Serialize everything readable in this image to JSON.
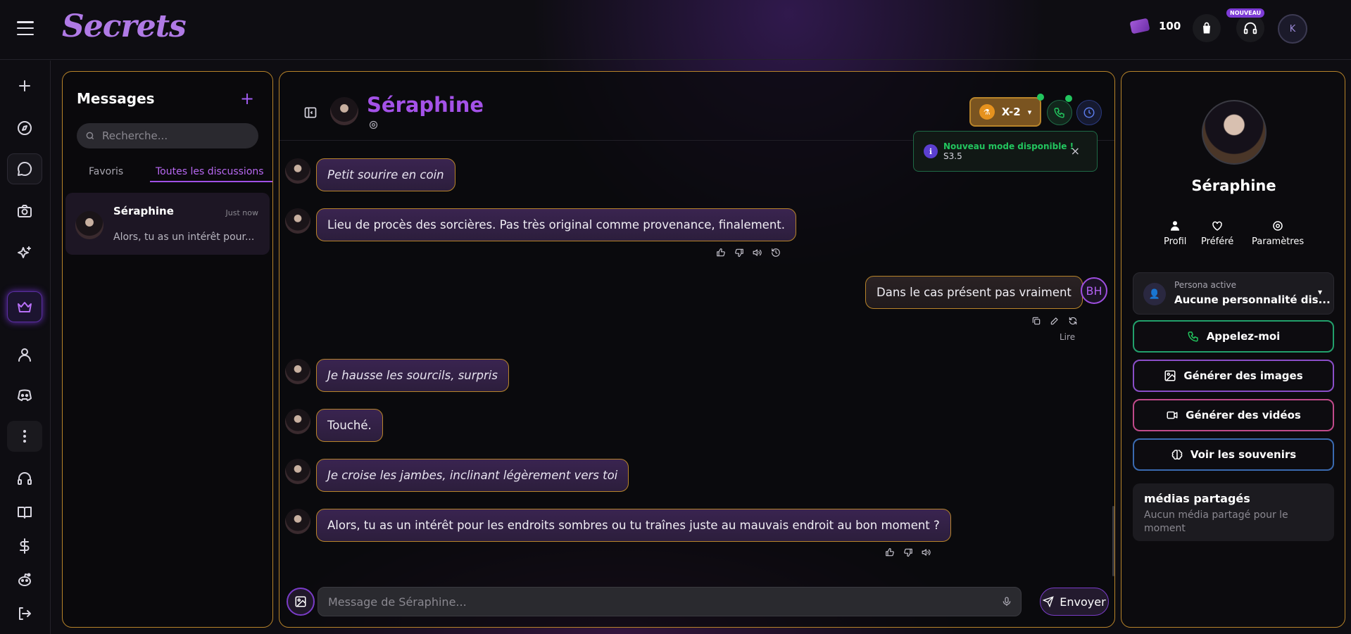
{
  "app": {
    "logo": "Secrets"
  },
  "topbar": {
    "gems_count": "100",
    "new_badge": "NOUVEAU",
    "user_initial": "K"
  },
  "messages": {
    "title": "Messages",
    "search_placeholder": "Recherche...",
    "tabs": [
      {
        "label": "Favoris"
      },
      {
        "label": "Toutes les discussions"
      }
    ],
    "conversations": [
      {
        "name": "Séraphine",
        "time": "Just now",
        "preview": "Alors, tu as un intérêt pour..."
      }
    ]
  },
  "chat": {
    "character_name": "Séraphine",
    "model_label": "X-2",
    "toast": {
      "title": "Nouveau mode disponible !",
      "subtitle": "S3.5",
      "close": "×"
    },
    "messages": [
      {
        "text": "Petit sourire en coin"
      },
      {
        "text": "Lieu de procès des sorcières. Pas très original comme provenance, finalement."
      },
      {
        "text": "Dans le cas présent pas vraiment",
        "user_initials": "BH",
        "read_label": "Lire"
      },
      {
        "text": "Je hausse les sourcils, surpris"
      },
      {
        "text": "Touché."
      },
      {
        "text": "Je croise les jambes, inclinant légèrement vers toi"
      },
      {
        "text": "Alors, tu as un intérêt pour les endroits sombres ou tu traînes juste au mauvais endroit au bon moment ?"
      }
    ],
    "input_placeholder": "Message de Séraphine...",
    "send_label": "Envoyer"
  },
  "profile": {
    "name": "Séraphine",
    "links": [
      {
        "label": "Profil"
      },
      {
        "label": "Préféré"
      },
      {
        "label": "Paramètres"
      }
    ],
    "persona": {
      "label": "Persona active",
      "value": "Aucune personnalité dis..."
    },
    "buttons": [
      {
        "label": "Appelez-moi",
        "color": "#22a06b"
      },
      {
        "label": "Générer des images",
        "color": "#8a4ec8"
      },
      {
        "label": "Générer des vidéos",
        "color": "#c04a8a"
      },
      {
        "label": "Voir les souvenirs",
        "color": "#3a6ab0"
      }
    ],
    "media": {
      "title": "médias partagés",
      "empty": "Aucun média partagé pour le moment"
    }
  },
  "colors": {
    "accent": "#a452e8",
    "border_gold": "#b8842a"
  }
}
